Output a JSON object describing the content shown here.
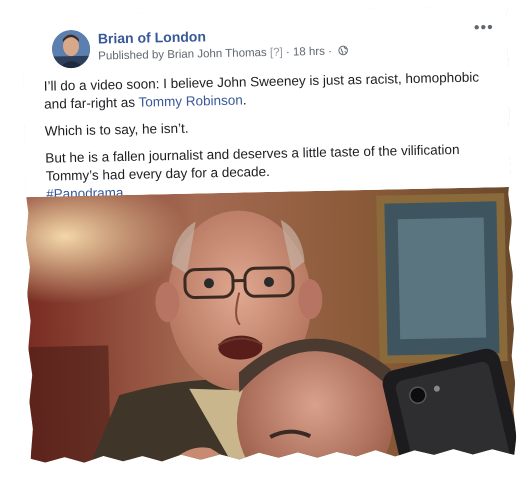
{
  "post": {
    "author": "Brian of London",
    "published_by_prefix": "Published by ",
    "publisher": "Brian John Thomas",
    "help": "[?]",
    "separator": " · ",
    "time": "18 hrs",
    "separator2": " · ",
    "privacy_icon": "globe-icon",
    "more_label": "•••",
    "text": {
      "p1_prefix": "I’ll do a video soon: I believe John Sweeney is just as racist, homophobic and far-right as ",
      "p1_link": "Tommy Robinson",
      "p1_suffix": ".",
      "p2": "Which is to say, he isn’t.",
      "p3": "But he is a fallen journalist and deserves a little taste of the vilification Tommy’s had every day for a decade.",
      "hashtag": "#Panodrama"
    }
  },
  "colors": {
    "link": "#385898",
    "text": "#1c1e21",
    "meta": "#606770"
  }
}
